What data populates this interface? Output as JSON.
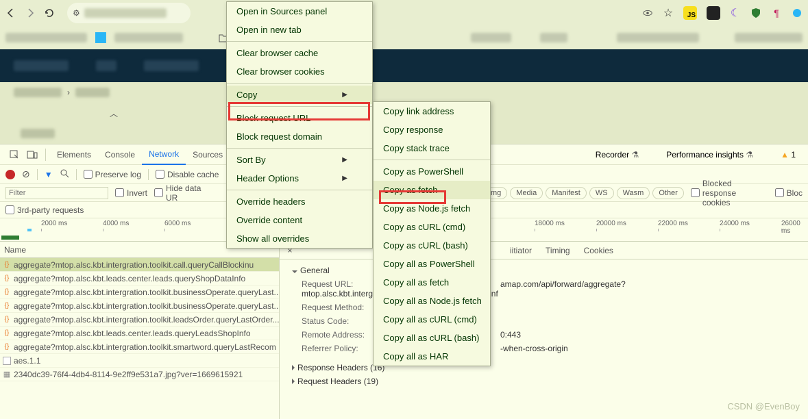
{
  "devtools": {
    "tabs": [
      "Elements",
      "Console",
      "Network",
      "Sources"
    ],
    "right": {
      "recorder": "Recorder",
      "perf": "Performance insights"
    },
    "warn_count": "1"
  },
  "netbar": {
    "preserve": "Preserve log",
    "disable": "Disable cache"
  },
  "filter": {
    "placeholder": "Filter",
    "invert": "Invert",
    "hideurl": "Hide data UR",
    "pills": [
      "Img",
      "Media",
      "Manifest",
      "WS",
      "Wasm",
      "Other"
    ],
    "blocked": "Blocked response cookies",
    "bloc2": "Bloc"
  },
  "third": {
    "label": "3rd-party requests"
  },
  "ticks": [
    "2000 ms",
    "4000 ms",
    "6000 ms",
    "18000 ms",
    "20000 ms",
    "22000 ms",
    "24000 ms",
    "26000 ms"
  ],
  "list": {
    "header": "Name",
    "rows": [
      {
        "t": "js",
        "n": "aggregate?mtop.alsc.kbt.intergration.toolkit.call.queryCallBlockinu",
        "sel": true
      },
      {
        "t": "js",
        "n": "aggregate?mtop.alsc.kbt.leads.center.leads.queryShopDataInfo"
      },
      {
        "t": "js",
        "n": "aggregate?mtop.alsc.kbt.intergration.toolkit.businessOperate.queryLast..."
      },
      {
        "t": "js",
        "n": "aggregate?mtop.alsc.kbt.intergration.toolkit.businessOperate.queryLast..."
      },
      {
        "t": "js",
        "n": "aggregate?mtop.alsc.kbt.intergration.toolkit.leadsOrder.queryLastOrder..."
      },
      {
        "t": "js",
        "n": "aggregate?mtop.alsc.kbt.leads.center.leads.queryLeadsShopInfo"
      },
      {
        "t": "js",
        "n": "aggregate?mtop.alsc.kbt.intergration.toolkit.smartword.queryLastRecom"
      },
      {
        "t": "txt",
        "n": "aes.1.1"
      },
      {
        "t": "img",
        "n": "2340dc39-76f4-4db4-8114-9e2ff9e531a7.jpg?ver=1669615921"
      }
    ]
  },
  "detail": {
    "tabs": [
      "iitiator",
      "Timing",
      "Cookies"
    ],
    "general": "General",
    "kv": {
      "url_k": "Request URL:",
      "url_v": "amap.com/api/forward/aggregate?mtop.alsc.kbt.intergration.toolkit.call.queryCallBlockInf",
      "method_k": "Request Method:",
      "status_k": "Status Code:",
      "remote_k": "Remote Address:",
      "remote_v": "0:443",
      "ref_k": "Referrer Policy:",
      "ref_v": "-when-cross-origin"
    },
    "resp_h": "Response Headers (16)",
    "req_h": "Request Headers (19)"
  },
  "ctx1": {
    "i1": "Open in Sources panel",
    "i2": "Open in new tab",
    "i3": "Clear browser cache",
    "i4": "Clear browser cookies",
    "i5": "Copy",
    "i6": "Block request URL",
    "i7": "Block request domain",
    "i8": "Sort By",
    "i9": "Header Options",
    "i10": "Override headers",
    "i11": "Override content",
    "i12": "Show all overrides"
  },
  "ctx2": {
    "c1": "Copy link address",
    "c2": "Copy response",
    "c3": "Copy stack trace",
    "c4": "Copy as PowerShell",
    "c5": "Copy as fetch",
    "c6": "Copy as Node.js fetch",
    "c7": "Copy as cURL (cmd)",
    "c8": "Copy as cURL (bash)",
    "c9": "Copy all as PowerShell",
    "c10": "Copy all as fetch",
    "c11": "Copy all as Node.js fetch",
    "c12": "Copy all as cURL (cmd)",
    "c13": "Copy all as cURL (bash)",
    "c14": "Copy all as HAR"
  },
  "watermark": "CSDN @EvenBoy"
}
